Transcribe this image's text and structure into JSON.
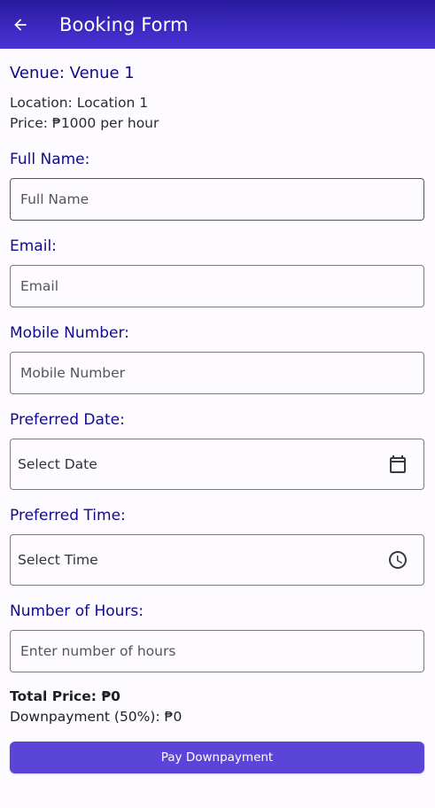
{
  "appbar": {
    "title": "Booking Form",
    "back_icon": "arrow-left-icon"
  },
  "venue": {
    "title": "Venue: Venue 1",
    "location": "Location: Location 1",
    "price": "Price: ₱1000 per hour"
  },
  "form": {
    "full_name": {
      "label": "Full Name:",
      "placeholder": "Full Name",
      "value": ""
    },
    "email": {
      "label": "Email:",
      "placeholder": "Email",
      "value": ""
    },
    "mobile": {
      "label": "Mobile Number:",
      "placeholder": "Mobile Number",
      "value": ""
    },
    "date": {
      "label": "Preferred Date:",
      "text": "Select Date",
      "icon": "calendar-icon"
    },
    "time": {
      "label": "Preferred Time:",
      "text": "Select Time",
      "icon": "clock-icon"
    },
    "hours": {
      "label": "Number of Hours:",
      "placeholder": "Enter number of hours",
      "value": ""
    }
  },
  "summary": {
    "total": "Total Price: ₱0",
    "downpayment": "Downpayment (50%): ₱0"
  },
  "actions": {
    "pay_label": "Pay Downpayment"
  },
  "colors": {
    "appbar": "#3a26c0",
    "label": "#100a8f",
    "button": "#5b45d9"
  }
}
